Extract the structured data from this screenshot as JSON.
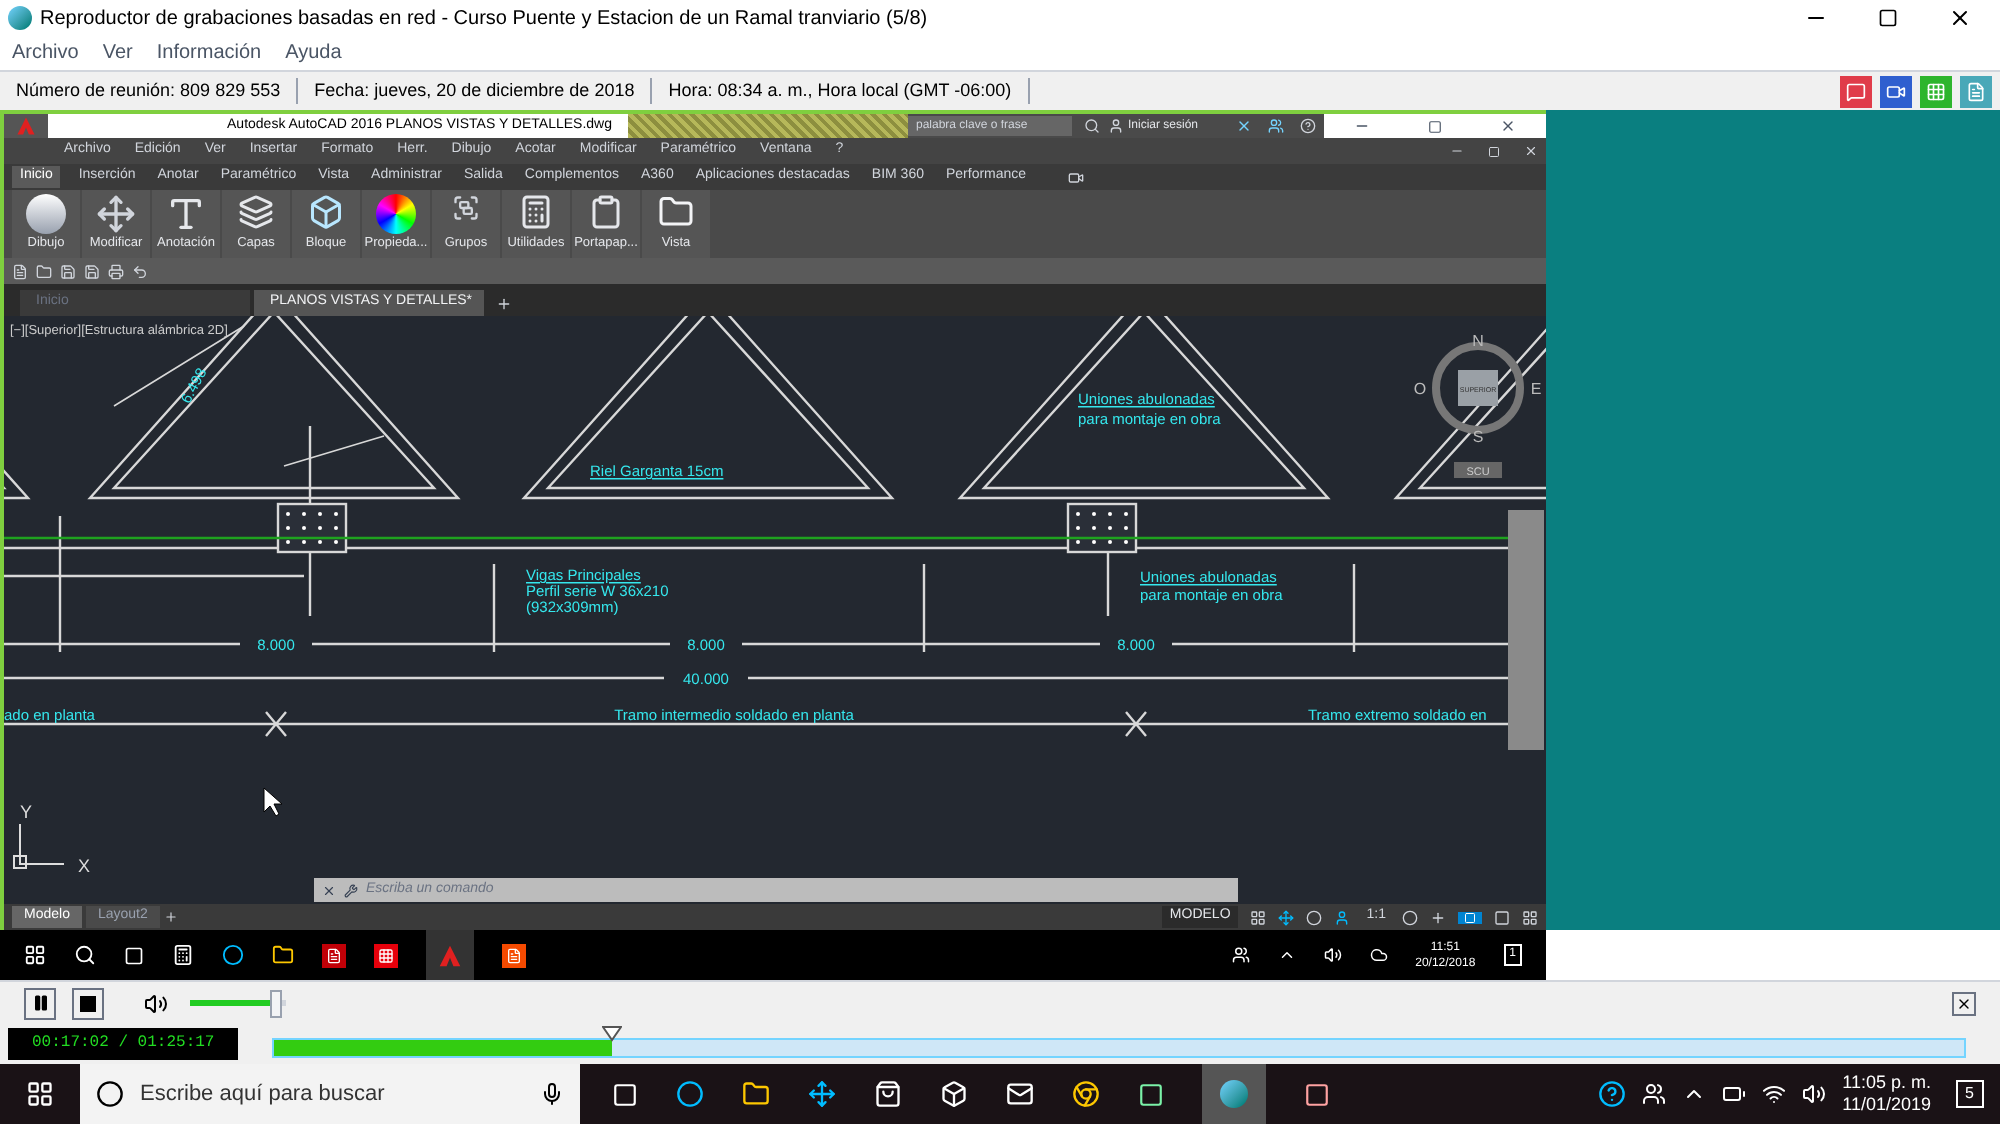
{
  "window": {
    "title": "Reproductor de grabaciones basadas en red - Curso Puente y Estacion de un Ramal tranviario (5/8)",
    "menu": [
      "Archivo",
      "Ver",
      "Información",
      "Ayuda"
    ]
  },
  "meeting_info": [
    "Número de reunión: 809 829 553",
    "Fecha: jueves, 20 de diciembre de 2018",
    "Hora: 08:34 a. m., Hora local (GMT -06:00)"
  ],
  "autocad": {
    "title": "Autodesk AutoCAD 2016   PLANOS VISTAS Y DETALLES.dwg",
    "search_placeholder": "palabra clave o frase",
    "sign_in": "Iniciar sesión",
    "menu": [
      "Archivo",
      "Edición",
      "Ver",
      "Insertar",
      "Formato",
      "Herr.",
      "Dibujo",
      "Acotar",
      "Modificar",
      "Paramétrico",
      "Ventana",
      "?"
    ],
    "ribbon_tabs": [
      {
        "label": "Inicio",
        "selected": true
      },
      {
        "label": "Inserción",
        "selected": false
      },
      {
        "label": "Anotar",
        "selected": false
      },
      {
        "label": "Paramétrico",
        "selected": false
      },
      {
        "label": "Vista",
        "selected": false
      },
      {
        "label": "Administrar",
        "selected": false
      },
      {
        "label": "Salida",
        "selected": false
      },
      {
        "label": "Complementos",
        "selected": false
      },
      {
        "label": "A360",
        "selected": false
      },
      {
        "label": "Aplicaciones destacadas",
        "selected": false
      },
      {
        "label": "BIM 360",
        "selected": false
      },
      {
        "label": "Performance",
        "selected": false
      }
    ],
    "panels": [
      "Dibujo",
      "Modificar",
      "Anotación",
      "Capas",
      "Bloque",
      "Propieda...",
      "Grupos",
      "Utilidades",
      "Portapap...",
      "Vista"
    ],
    "file_tabs": [
      {
        "label": "Inicio",
        "selected": false
      },
      {
        "label": "PLANOS VISTAS Y DETALLES*",
        "selected": true
      }
    ],
    "viewport_label": "[−][Superior][Estructura alámbrica 2D]",
    "annotations": [
      "6.498",
      "Uniones abulonadas",
      "para montaje en obra",
      "Riel Garganta 15cm",
      "Vigas Principales",
      "Perfil serie W 36x210",
      "(932x309mm)",
      "Uniones abulonadas",
      "para montaje en obra",
      "8.000",
      "8.000",
      "8.000",
      "40.000",
      "ado en planta",
      "Tramo intermedio soldado en planta",
      "Tramo extremo soldado en"
    ],
    "viewcube": {
      "north": "N",
      "south": "S",
      "east": "E",
      "west": "O",
      "face": "SUPERIOR",
      "ucs": "SCU"
    },
    "axes": {
      "y": "Y",
      "x": "X"
    },
    "command_placeholder": "Escriba un comando",
    "layout_tabs": [
      {
        "label": "Modelo",
        "selected": true
      },
      {
        "label": "Layout2",
        "selected": false
      }
    ],
    "status_model": "MODELO",
    "scale": "1:1"
  },
  "remote_taskbar": {
    "time": "11:51",
    "date": "20/12/2018",
    "notifications": "1"
  },
  "player": {
    "volume": {
      "level": 0.9
    },
    "time": "00:17:02 / 01:25:17",
    "progress": {
      "level": 0.2
    }
  },
  "taskbar": {
    "search_placeholder": "Escribe aquí para buscar",
    "time": "11:05 p. m.",
    "date": "11/01/2019",
    "notifications": "5"
  }
}
